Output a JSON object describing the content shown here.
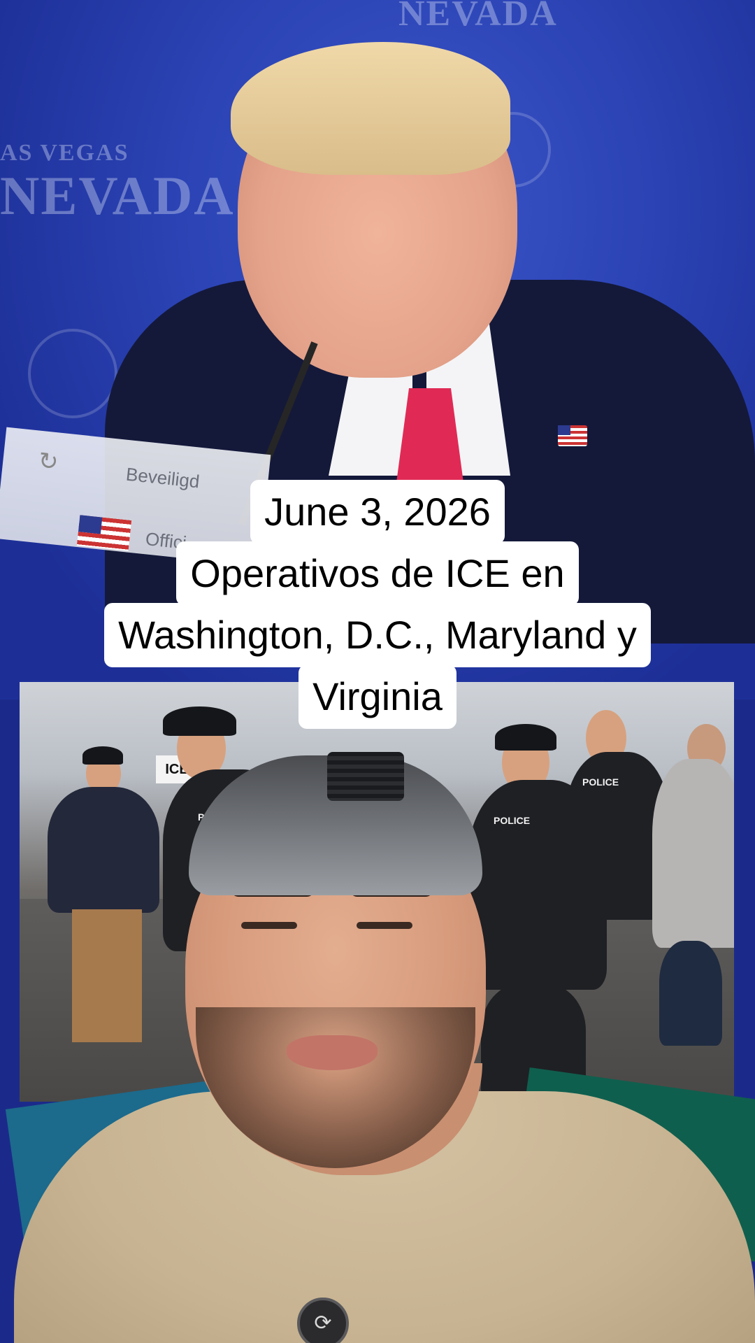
{
  "background": {
    "backdrop_text_top": "NEVADA",
    "backdrop_text_left_small": "AS VEGAS",
    "backdrop_text_left_large": "NEVADA",
    "screen_fragment_text_1": "Beveiligd",
    "screen_fragment_text_2": "Offici",
    "accent_suit": "#14193a",
    "accent_tie": "#e02a55",
    "backdrop_color": "#2b43b4"
  },
  "caption": {
    "line_1": "June 3, 2026",
    "line_2": "Operativos de ICE en",
    "line_3": "Washington, D.C., Maryland y",
    "line_4": "Virginia"
  },
  "embedded_photo": {
    "sign_text": "ICE",
    "badge_texts": [
      "POLICE",
      "POLICE",
      "POLICE"
    ]
  },
  "presenter": {
    "shirt_color": "#c7b391",
    "cap_color": "#6d7075"
  },
  "icons": {
    "mic_button_icon": "mic-clip-icon",
    "reload_icon": "reload-icon"
  }
}
